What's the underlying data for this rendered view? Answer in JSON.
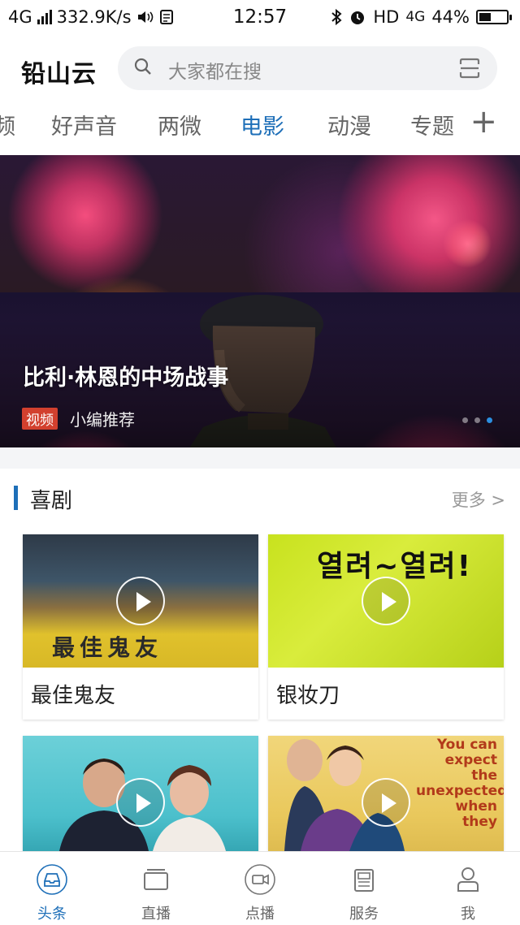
{
  "status_bar": {
    "network": "4G",
    "speed": "332.9K/s",
    "time": "12:57",
    "hd": "HD",
    "network_right": "4G",
    "battery": "44%",
    "battery_level": 0.44
  },
  "header": {
    "brand": "铅山云",
    "search_placeholder": "大家都在搜"
  },
  "tabs": [
    {
      "label": "频",
      "active": false
    },
    {
      "label": "好声音",
      "active": false
    },
    {
      "label": "两微",
      "active": false
    },
    {
      "label": "电影",
      "active": true
    },
    {
      "label": "动漫",
      "active": false
    },
    {
      "label": "专题",
      "active": false
    }
  ],
  "tab_add": "+",
  "banner": {
    "title": "比利·林恩的中场战事",
    "badge": "视频",
    "subtitle": "小编推荐",
    "page_count": 3,
    "current_page": 3
  },
  "section": {
    "title": "喜剧",
    "more": "更多 >"
  },
  "cards": [
    {
      "name": "最佳鬼友",
      "thumb_text": "最佳鬼友"
    },
    {
      "name": "银妆刀",
      "thumb_text": "열려~열려!"
    },
    {
      "name": "",
      "thumb_text": ""
    },
    {
      "name": "",
      "thumb_text": "You can expect the unexpected when they"
    }
  ],
  "bottom_nav": [
    {
      "label": "头条",
      "icon": "news-tray-icon",
      "active": true
    },
    {
      "label": "直播",
      "icon": "live-tv-icon",
      "active": false
    },
    {
      "label": "点播",
      "icon": "video-camera-icon",
      "active": false
    },
    {
      "label": "服务",
      "icon": "document-icon",
      "active": false
    },
    {
      "label": "我",
      "icon": "user-icon",
      "active": false
    }
  ],
  "colors": {
    "accent": "#1e6fb8",
    "badge": "#d2402e"
  }
}
